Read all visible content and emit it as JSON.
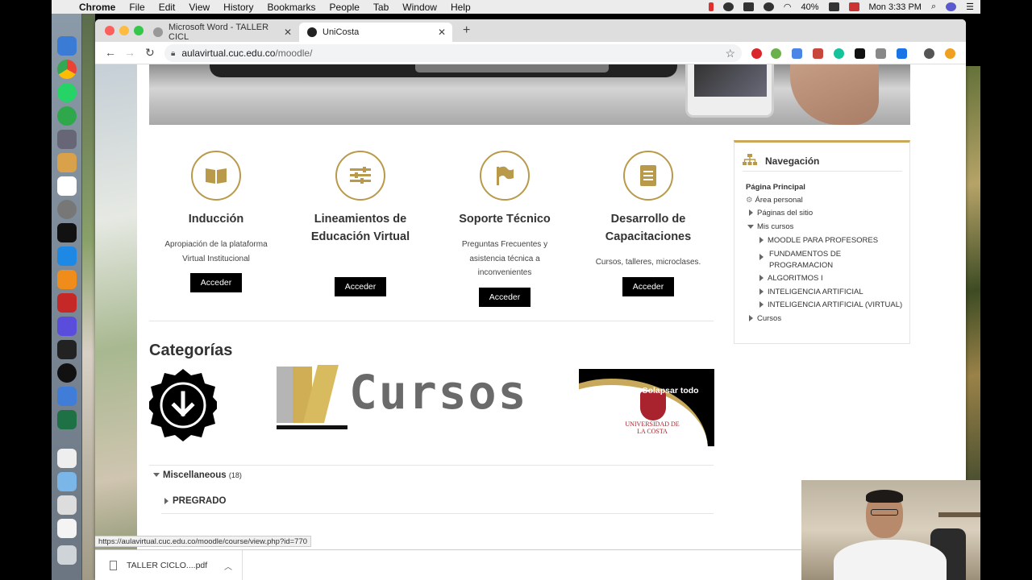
{
  "menubar": {
    "app": "Chrome",
    "items": [
      "File",
      "Edit",
      "View",
      "History",
      "Bookmarks",
      "People",
      "Tab",
      "Window",
      "Help"
    ],
    "battery": "40%",
    "clock": "Mon 3:33 PM"
  },
  "browser": {
    "tabs": [
      {
        "title": "Microsoft Word - TALLER CICL",
        "active": false
      },
      {
        "title": "UniCosta",
        "active": true
      }
    ],
    "url_domain": "aulavirtual.cuc.edu.co",
    "url_path": "/moodle/"
  },
  "cards": [
    {
      "title": "Inducción",
      "desc": "Apropiación de la plataforma Virtual Institucional",
      "button": "Acceder",
      "icon": "book-icon"
    },
    {
      "title": "Lineamientos de Educación Virtual",
      "desc": "",
      "button": "Acceder",
      "icon": "sliders-icon"
    },
    {
      "title": "Soporte Técnico",
      "desc": "Preguntas Frecuentes y asistencia técnica a inconvenientes",
      "button": "Acceder",
      "icon": "flag-icon"
    },
    {
      "title": "Desarrollo de Capacitaciones",
      "desc": "Cursos, talleres, microclases.",
      "button": "Acceder",
      "icon": "document-icon"
    }
  ],
  "categories": {
    "title": "Categorías",
    "logo_word": "Cursos",
    "collapse_all": "Colapsar todo",
    "university": "UNIVERSIDAD DE LA COSTA",
    "misc_label": "Miscellaneous",
    "misc_count": "(18)",
    "pregrado": "PREGRADO"
  },
  "navigation": {
    "title": "Navegación",
    "home": "Página Principal",
    "personal_area": "Área personal",
    "site_pages": "Páginas del sitio",
    "my_courses": "Mis cursos",
    "courses": [
      "MOODLE PARA PROFESORES",
      "FUNDAMENTOS DE PROGRAMACION",
      "ALGORITMOS I",
      "INTELIGENCIA ARTIFICIAL",
      "INTELIGENCIA ARTIFICIAL (VIRTUAL)"
    ],
    "cursos": "Cursos"
  },
  "statusbar": {
    "link": "https://aulavirtual.cuc.edu.co/moodle/course/view.php?id=770"
  },
  "downloads": {
    "file": "TALLER CICLO....pdf"
  },
  "colors": {
    "accent_gold": "#b99a4b",
    "button_black": "#000000",
    "brand_red": "#a8232d"
  }
}
